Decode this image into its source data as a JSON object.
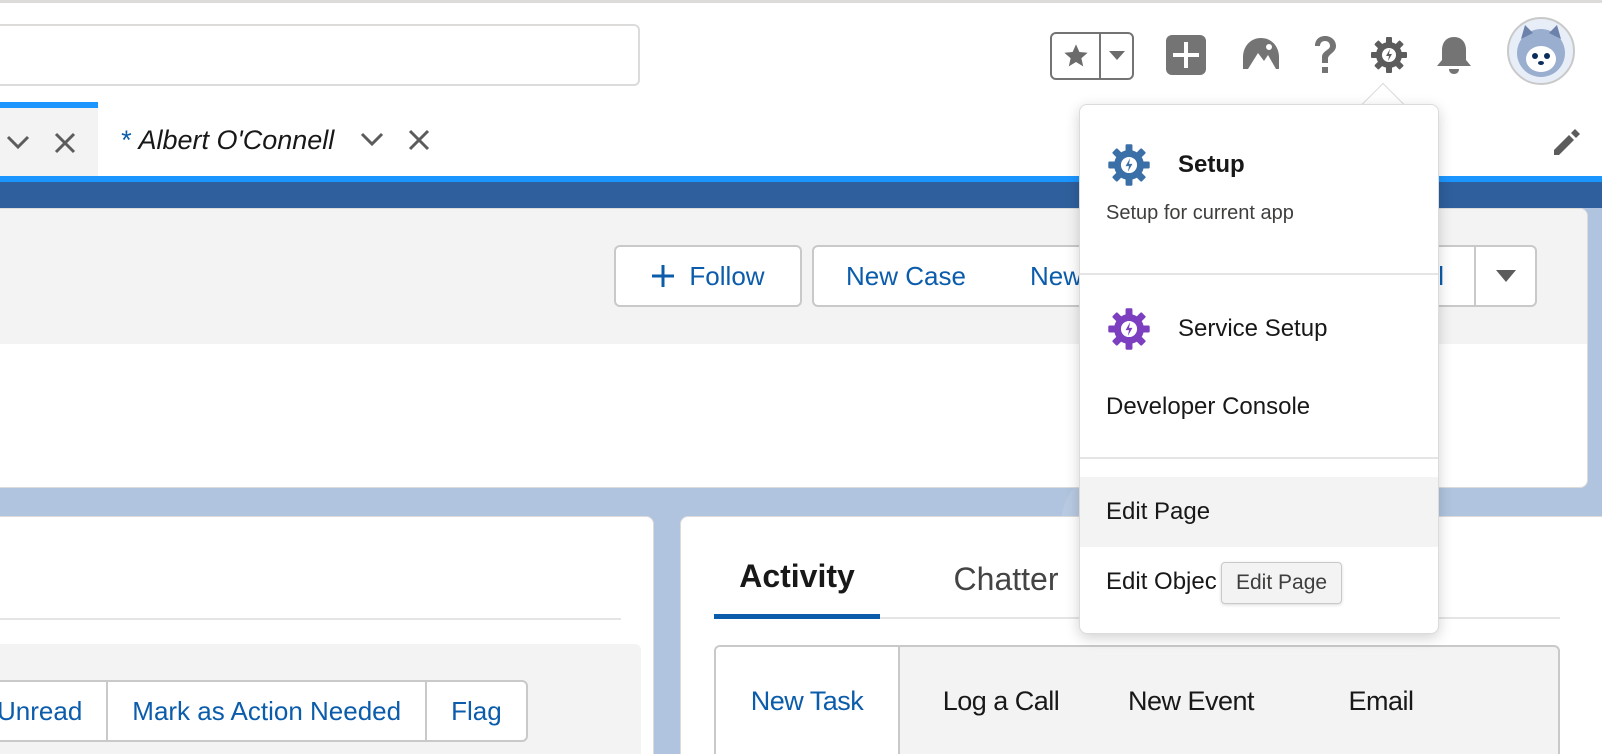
{
  "header": {
    "favorites": {
      "star_icon": "star-icon",
      "menu_icon": "chevron-down-icon"
    },
    "icons": [
      "plus-square-icon",
      "trailhead-icon",
      "help-icon",
      "gear-icon",
      "bell-icon"
    ]
  },
  "tabs": {
    "active_prefix": "*",
    "active_label": "Albert O'Connell"
  },
  "highlights": {
    "follow_label": "Follow",
    "new_case_label": "New Case",
    "new_partial_label": "New",
    "al_partial_label": "al"
  },
  "left_card": {
    "buttons": [
      "Unread",
      "Mark as Action Needed",
      "Flag"
    ]
  },
  "right_card": {
    "tabs": [
      "Activity",
      "Chatter"
    ],
    "publisher_tabs": [
      "New Task",
      "Log a Call",
      "New Event",
      "Email"
    ]
  },
  "setup_menu": {
    "setup_label": "Setup",
    "setup_desc": "Setup for current app",
    "service_setup_label": "Service Setup",
    "developer_console_label": "Developer Console",
    "edit_page_label": "Edit Page",
    "edit_object_label": "Edit Objec"
  },
  "tooltip": {
    "text": "Edit Page"
  },
  "colors": {
    "brand_blue": "#0b5cab",
    "tab_accent": "#1b96ff",
    "setup_gear": "#3b6fa8",
    "service_gear": "#7b3fbf"
  }
}
